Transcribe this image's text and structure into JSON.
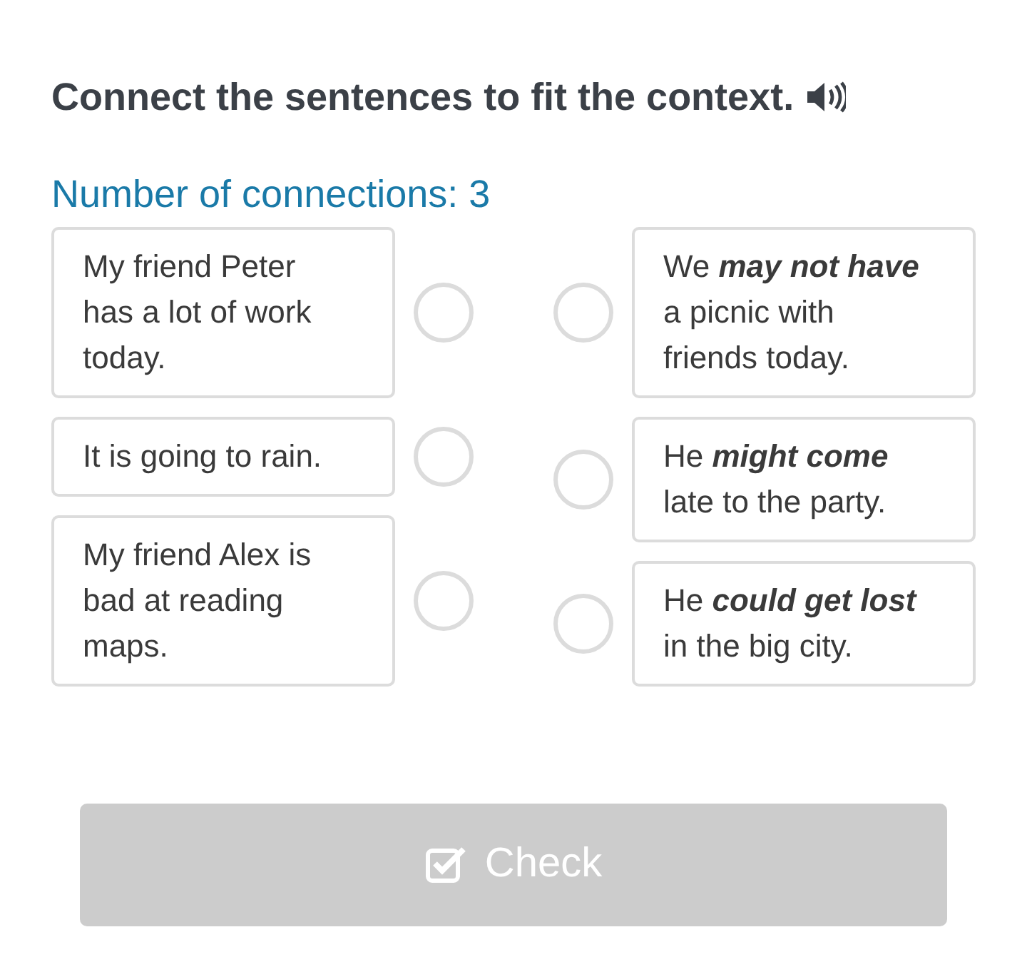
{
  "title": "Connect the sentences to fit the context.",
  "connections_label": "Number of connections: 3",
  "left_items": [
    {
      "text": "My friend Peter has a lot of work today.",
      "selected": false
    },
    {
      "text": "It is going to rain.",
      "selected": false
    },
    {
      "text": "My friend Alex is bad at reading maps.",
      "selected": false
    }
  ],
  "right_items": [
    {
      "text": "We **may not have** a picnic with friends today.",
      "selected": false
    },
    {
      "text": "He **might come** late to the party.",
      "selected": false
    },
    {
      "text": "He **could get lost** in the big city.",
      "selected": false
    }
  ],
  "check_button": {
    "label": "Check",
    "disabled": true
  }
}
